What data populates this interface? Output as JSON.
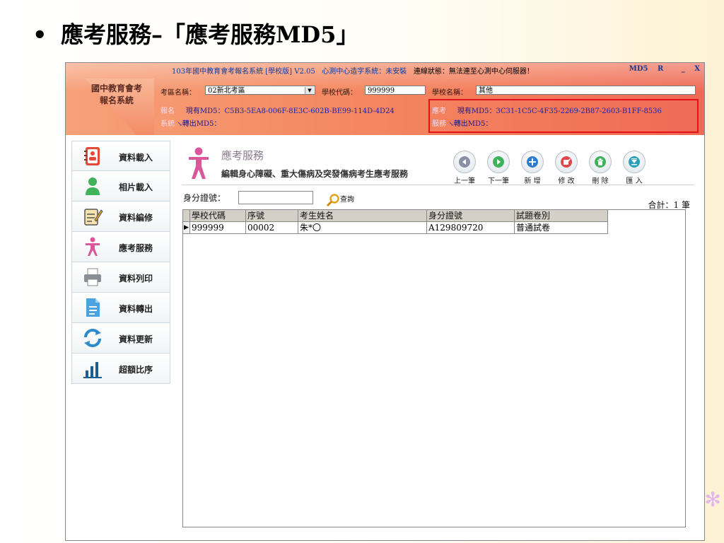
{
  "slide": {
    "bullet": "•",
    "title": "應考服務–「應考服務MD5」"
  },
  "app": {
    "title": "103年國中教育會考報名系統 [學校版] V2.05",
    "bridge_label": "心測中心造字系統：",
    "bridge_status": "未安裝",
    "connection_label": "連線狀態：",
    "connection_status": "無法連至心測中心伺服器！",
    "window_buttons": [
      "MD5",
      "R",
      "_",
      "X"
    ],
    "logo_line1": "國中教育會考",
    "logo_line2": "報名系統",
    "exam_area_label": "考區名稱：",
    "exam_area_value": "02新北考區",
    "school_code_label": "學校代碼：",
    "school_code_value": "999999",
    "school_name_label": "學校名稱：",
    "school_name_value": "其他",
    "reg": {
      "side1": "報名",
      "side2": "系統",
      "current_label": "現有MD5：",
      "current_value": "C5B3-5EA8-006F-8E3C-602B-BE99-114D-4D24",
      "export_label": "轉出MD5："
    },
    "svc": {
      "side1": "應考",
      "side2": "服務",
      "current_label": "現有MD5：",
      "current_value": "3C31-1C5C-4F35-2269-2B87-2603-B1FF-8536",
      "export_label": "轉出MD5："
    }
  },
  "sidebar": {
    "items": [
      {
        "label": "資料載入",
        "icon": "contacts-book-icon"
      },
      {
        "label": "相片載入",
        "icon": "person-icon"
      },
      {
        "label": "資料編修",
        "icon": "edit-document-icon"
      },
      {
        "label": "應考服務",
        "icon": "accessibility-person-icon"
      },
      {
        "label": "資料列印",
        "icon": "printer-icon"
      },
      {
        "label": "資料轉出",
        "icon": "export-document-icon"
      },
      {
        "label": "資料更新",
        "icon": "refresh-icon"
      },
      {
        "label": "超額比序",
        "icon": "bar-chart-icon"
      }
    ]
  },
  "main": {
    "title": "應考服務",
    "subtitle": "編輯身心障礙、重大傷病及突發傷病考生應考服務",
    "toolbar": [
      {
        "label": "上一筆",
        "icon": "prev-arrow-icon"
      },
      {
        "label": "下一筆",
        "icon": "next-arrow-icon"
      },
      {
        "label": "新 增",
        "icon": "plus-icon"
      },
      {
        "label": "修 改",
        "icon": "edit-icon"
      },
      {
        "label": "刪 除",
        "icon": "trash-icon"
      },
      {
        "label": "匯 入",
        "icon": "import-icon"
      }
    ],
    "id_label": "身分證號：",
    "id_value": "",
    "query_label": "查詢",
    "total": "合計：1 筆",
    "table": {
      "headers": [
        "學校代碼",
        "序號",
        "考生姓名",
        "身分證號",
        "試題卷別"
      ],
      "rows": [
        [
          "999999",
          "00002",
          "朱*〇",
          "A129809720",
          "普通試卷"
        ]
      ]
    }
  },
  "colors": {
    "header_start": "#f7a17a",
    "header_end": "#ee6a55",
    "highlight_box": "#e4101a",
    "link_blue": "#1e3cd8"
  }
}
